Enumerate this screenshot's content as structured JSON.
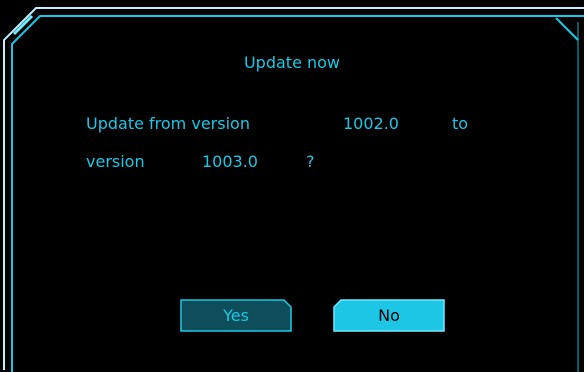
{
  "dialog": {
    "title": "Update now",
    "message_line1": {
      "prefix": "Update  from  version",
      "from_version": "1002.0",
      "to_word": "to"
    },
    "message_line2": {
      "prefix": "version",
      "to_version": "1003.0",
      "question_mark": "?"
    },
    "buttons": {
      "yes_label": "Yes",
      "no_label": "No"
    }
  },
  "colors": {
    "accent": "#19c8e6",
    "background": "#000000",
    "frame_glow": "#6fe9ff",
    "button_dark_fill": "#0e4e5a",
    "button_bright_fill": "#1ec6e6"
  }
}
